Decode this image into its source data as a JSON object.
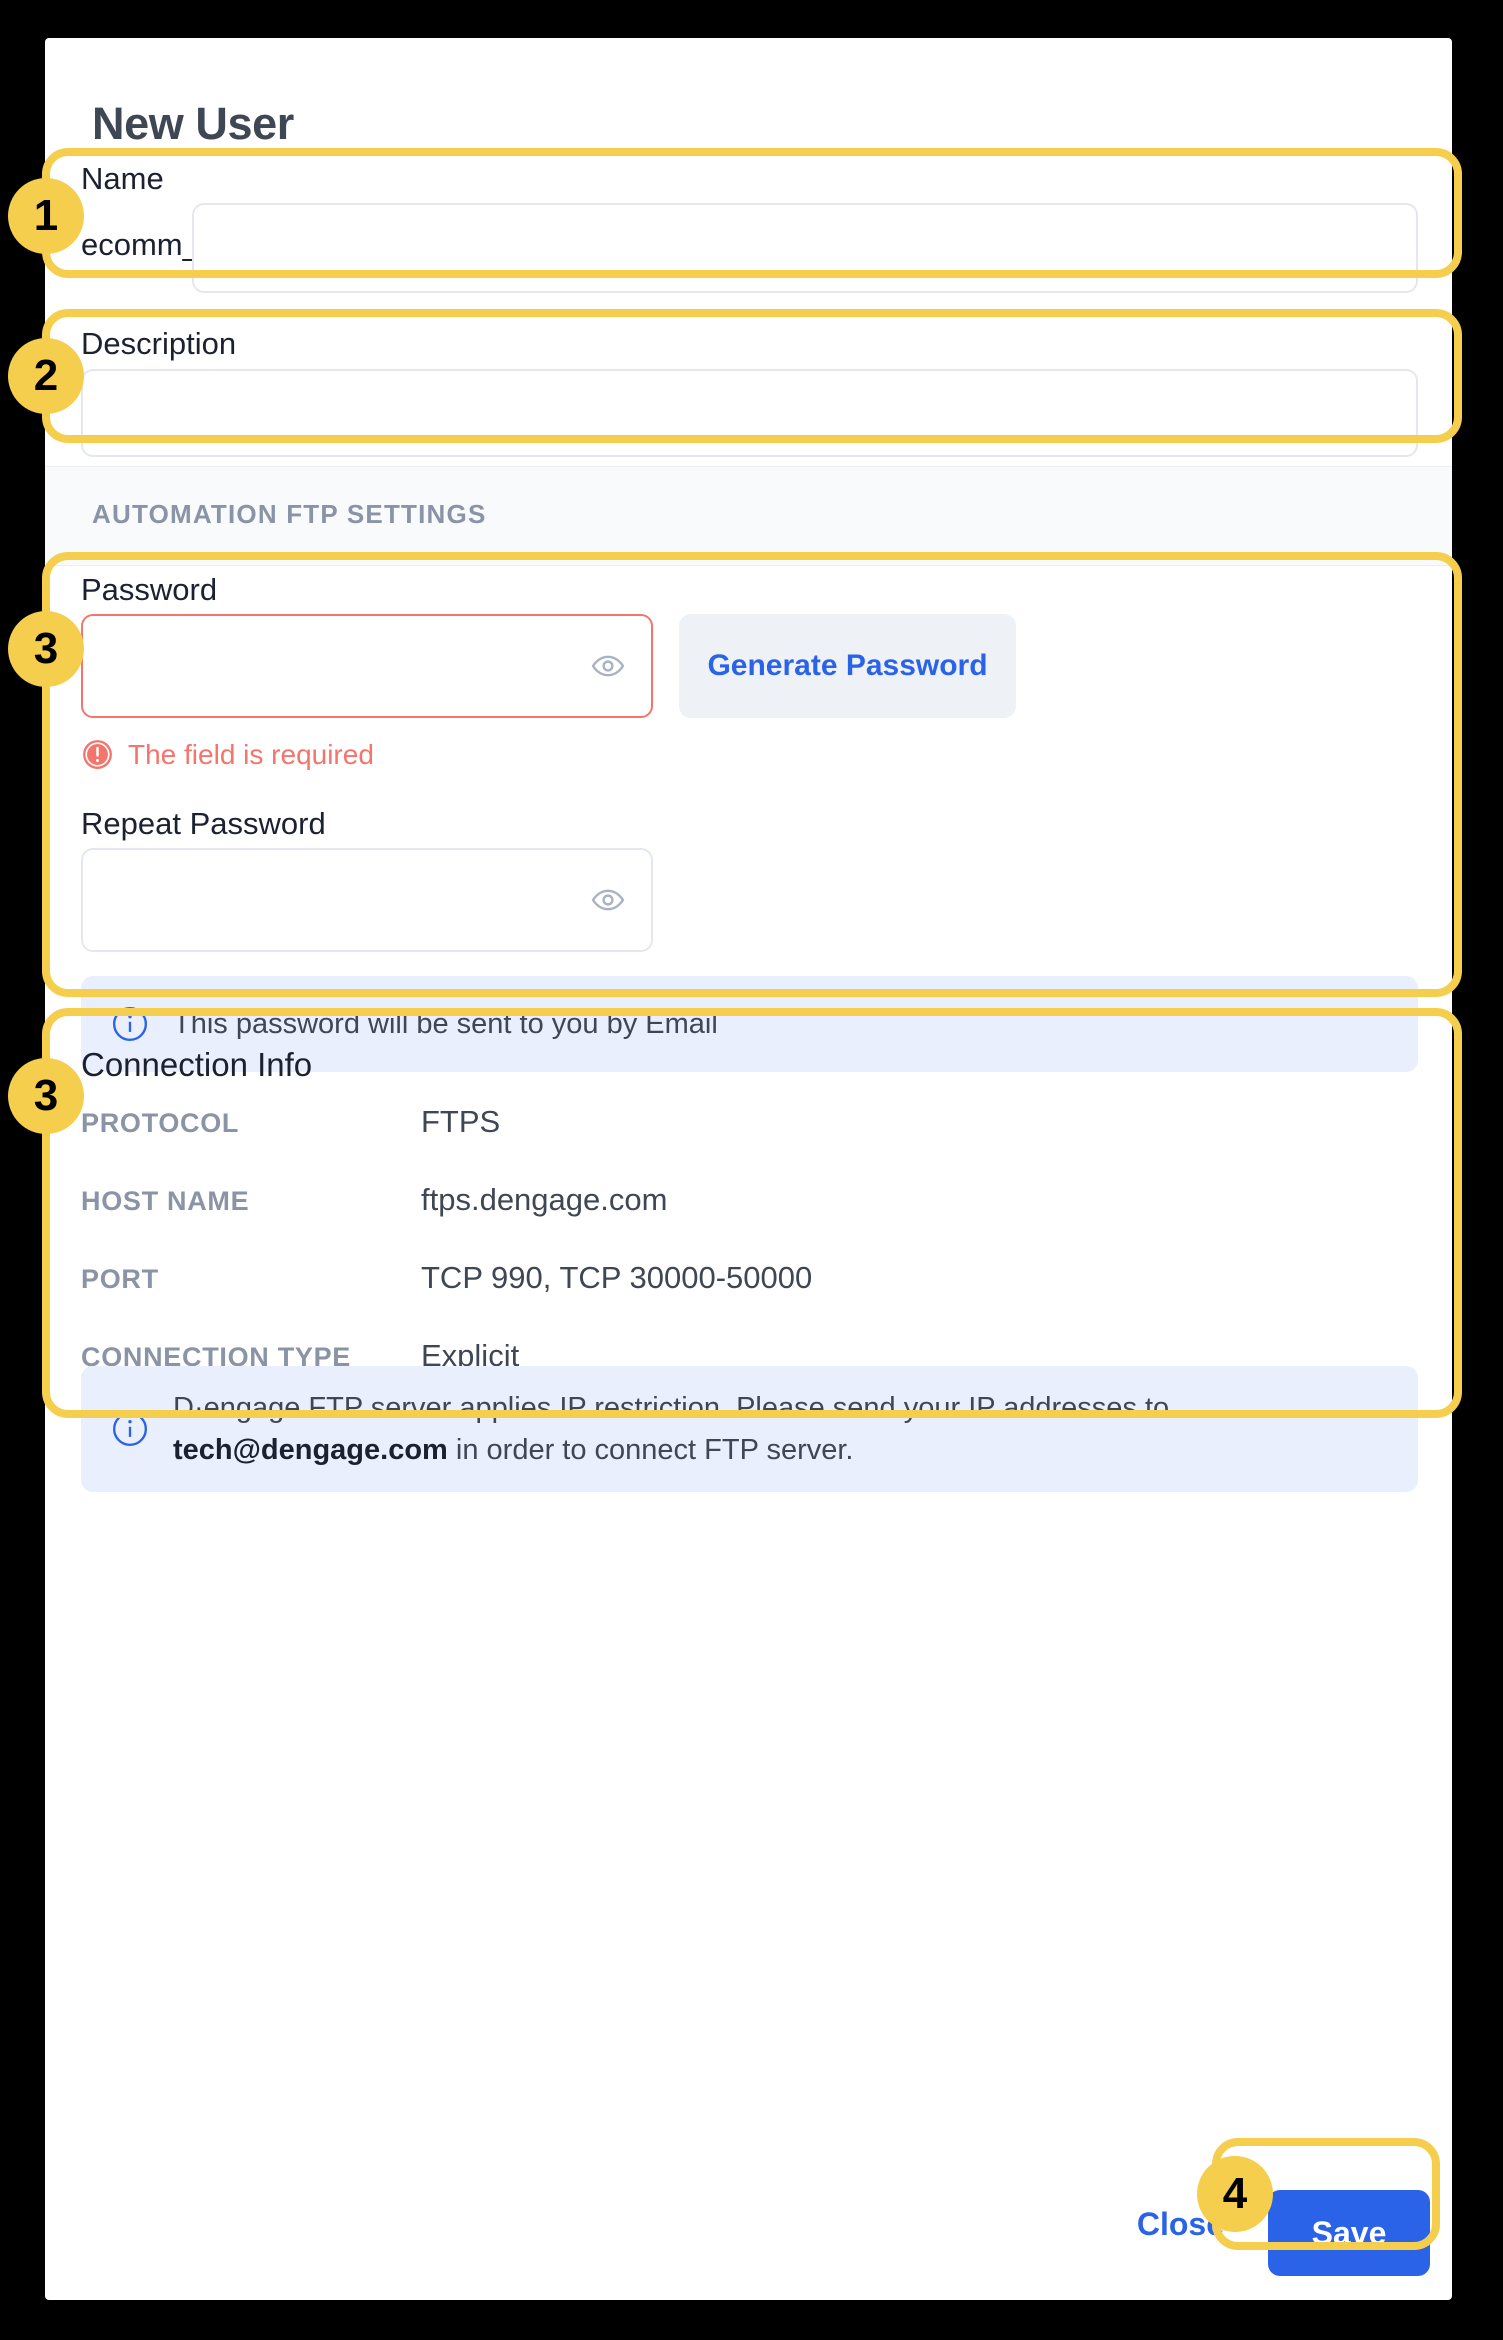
{
  "dialog": {
    "title": "New User"
  },
  "name_field": {
    "label": "Name",
    "prefix": "ecomm_",
    "value": "",
    "placeholder": ""
  },
  "description_field": {
    "label": "Description",
    "value": "",
    "placeholder": ""
  },
  "section": {
    "heading": "AUTOMATION FTP SETTINGS"
  },
  "password_field": {
    "label": "Password",
    "value": "",
    "placeholder": "",
    "error": "The field is required",
    "toggle_icon": "eye-icon",
    "error_icon": "error-circle-icon"
  },
  "generate_password_button": {
    "label": "Generate Password"
  },
  "repeat_password_field": {
    "label": "Repeat Password",
    "value": "",
    "placeholder": "",
    "toggle_icon": "eye-icon"
  },
  "password_banner": {
    "icon": "info-circle-icon",
    "text": "This password will be sent to you by Email"
  },
  "connection_info": {
    "title": "Connection Info",
    "rows": [
      {
        "key": "PROTOCOL",
        "value": "FTPS"
      },
      {
        "key": "HOST NAME",
        "value": "ftps.dengage.com"
      },
      {
        "key": "PORT",
        "value": "TCP 990, TCP 30000-50000"
      },
      {
        "key": "CONNECTION TYPE",
        "value": "Explicit"
      }
    ]
  },
  "connection_banner": {
    "icon": "info-circle-icon",
    "text_before": "D·engage FTP server applies IP restriction. Please send your IP addresses to ",
    "email": "tech@dengage.com",
    "text_after": " in order to connect FTP server."
  },
  "footer": {
    "close_label": "Close",
    "save_label": "Save"
  },
  "annotations": {
    "badges": [
      "1",
      "2",
      "3",
      "3",
      "4"
    ]
  },
  "colors": {
    "annotation": "#F5CE4E",
    "primary": "#2B63E8",
    "error": "#F4756B",
    "banner_bg": "#E9EFFC",
    "muted": "#8A94A6",
    "text": "#1B2131"
  }
}
